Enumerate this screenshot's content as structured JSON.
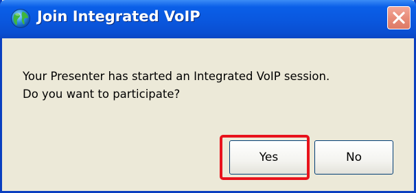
{
  "window": {
    "title": "Join Integrated VoIP",
    "title_icon": "globe-icon",
    "close_icon": "close-icon"
  },
  "message": {
    "line1": "Your Presenter has started an Integrated VoIP session.",
    "line2": "Do you want to participate?"
  },
  "buttons": {
    "yes_label": "Yes",
    "no_label": "No"
  },
  "colors": {
    "titlebar": "#0a57de",
    "dialog_background": "#ece9d8",
    "close_button": "#e88c79",
    "highlight": "#e8121b"
  }
}
